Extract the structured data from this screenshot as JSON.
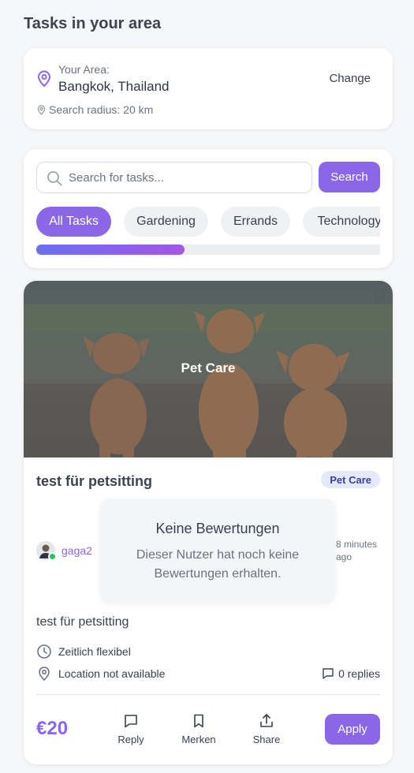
{
  "page": {
    "title": "Tasks in your area"
  },
  "area": {
    "label": "Your Area:",
    "value": "Bangkok, Thailand",
    "change_label": "Change",
    "radius_text": "Search radius: 20 km"
  },
  "search": {
    "placeholder": "Search for tasks...",
    "value": "",
    "button_label": "Search"
  },
  "categories": [
    {
      "label": "All Tasks",
      "active": true
    },
    {
      "label": "Gardening",
      "active": false
    },
    {
      "label": "Errands",
      "active": false
    },
    {
      "label": "Technology",
      "active": false
    }
  ],
  "task": {
    "image_label": "Pet Care",
    "title": "test für petsitting",
    "category_badge": "Pet Care",
    "username": "gaga2",
    "online": true,
    "time_ago": "8 minutes ago",
    "rating_popup": {
      "title": "Keine Bewertungen",
      "text": "Dieser Nutzer hat noch keine Bewertungen erhalten."
    },
    "description": "test für petsitting",
    "schedule": "Zeitlich flexibel",
    "location": "Location not available",
    "replies": "0 replies",
    "price": "€20",
    "actions": {
      "reply": "Reply",
      "save": "Merken",
      "share": "Share"
    },
    "apply_label": "Apply"
  },
  "colors": {
    "accent": "#8b67e8",
    "badge_bg": "#e6e8fb",
    "badge_text": "#3b3fa8",
    "online": "#22c55e"
  },
  "icons": [
    "map-pin-icon",
    "search-icon",
    "bookmark-icon",
    "clock-icon",
    "chat-icon",
    "share-icon"
  ]
}
